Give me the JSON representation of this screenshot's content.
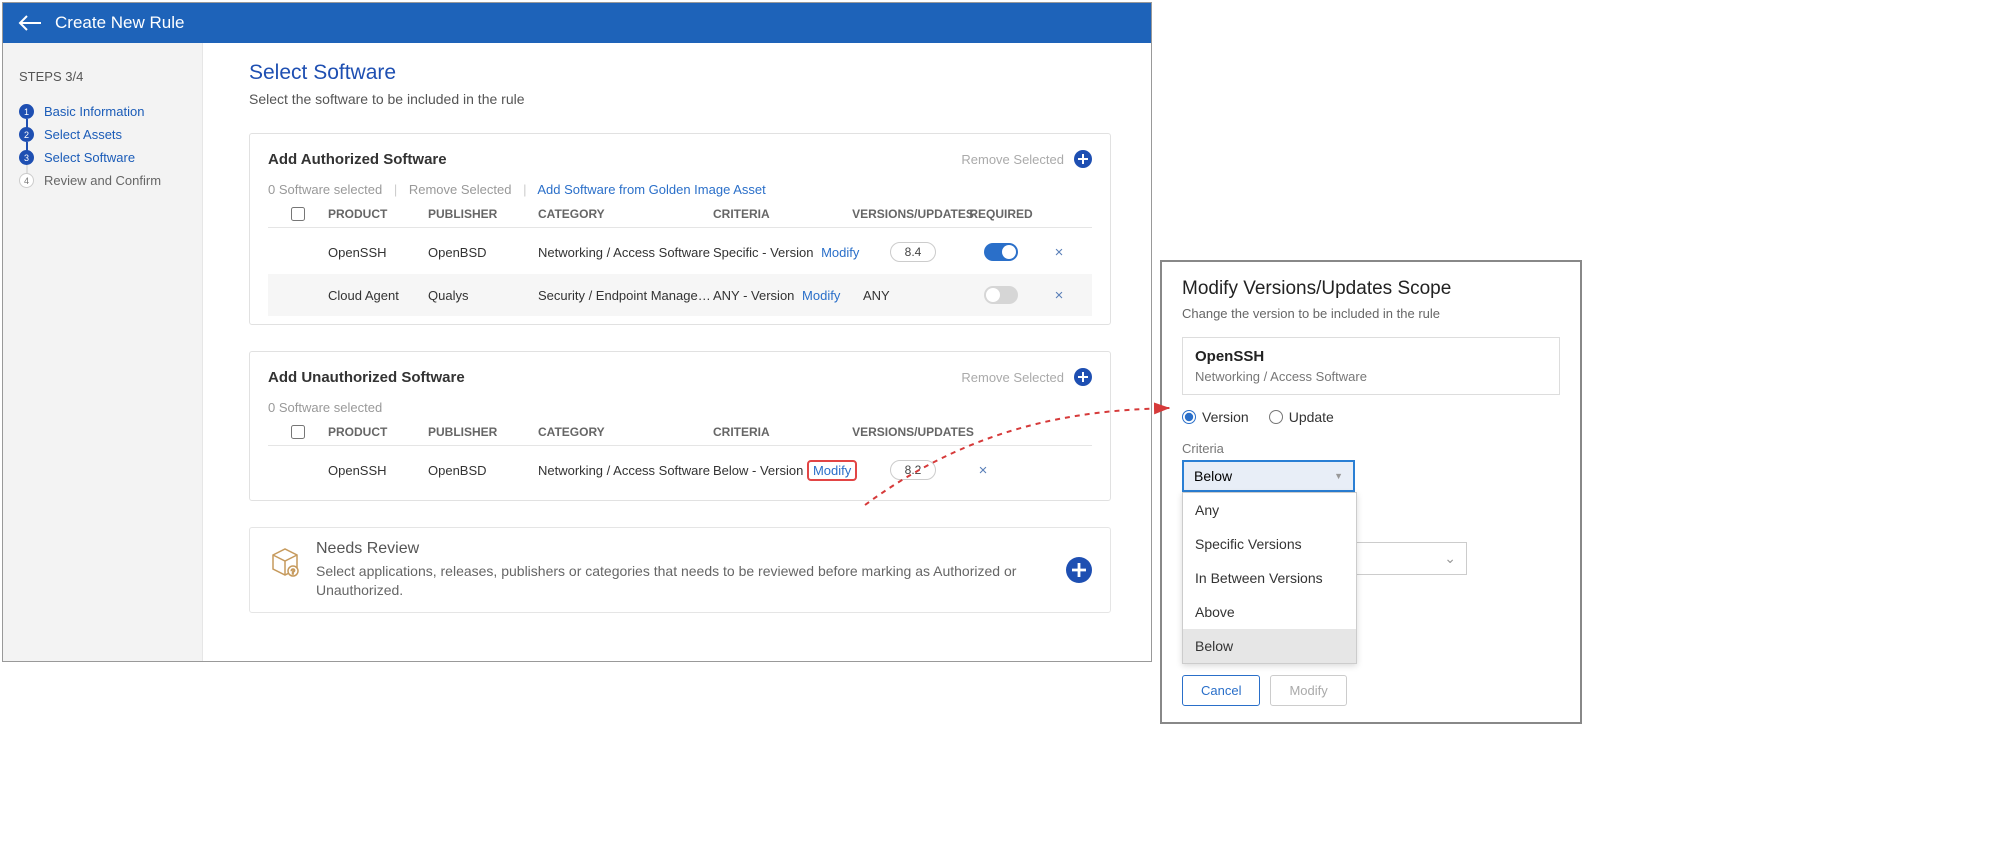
{
  "header": {
    "title": "Create New Rule"
  },
  "sidebar": {
    "steps_label": "STEPS 3/4",
    "steps": [
      {
        "num": "1",
        "label": "Basic Information",
        "done": true
      },
      {
        "num": "2",
        "label": "Select Assets",
        "done": true
      },
      {
        "num": "3",
        "label": "Select Software",
        "done": true
      },
      {
        "num": "4",
        "label": "Review and Confirm",
        "done": false
      }
    ]
  },
  "main": {
    "title": "Select Software",
    "subtitle": "Select the software to be included in the rule"
  },
  "auth": {
    "title": "Add Authorized Software",
    "remove_selected": "Remove Selected",
    "selbar_selected": "0 Software selected",
    "selbar_remove": "Remove Selected",
    "selbar_golden": "Add Software from Golden Image Asset",
    "headers": {
      "product": "PRODUCT",
      "publisher": "PUBLISHER",
      "category": "CATEGORY",
      "criteria": "CRITERIA",
      "versions": "VERSIONS/UPDATES",
      "required": "REQUIRED"
    },
    "rows": [
      {
        "product": "OpenSSH",
        "publisher": "OpenBSD",
        "category": "Networking / Access Software",
        "criteria": "Specific - Version",
        "modify": "Modify",
        "version": "8.4",
        "required_on": true
      },
      {
        "product": "Cloud Agent",
        "publisher": "Qualys",
        "category": "Security / Endpoint Managem...",
        "criteria": "ANY - Version",
        "modify": "Modify",
        "version": "ANY",
        "required_on": false
      }
    ]
  },
  "unauth": {
    "title": "Add Unauthorized Software",
    "remove_selected": "Remove Selected",
    "selbar_selected": "0 Software selected",
    "headers": {
      "product": "PRODUCT",
      "publisher": "PUBLISHER",
      "category": "CATEGORY",
      "criteria": "CRITERIA",
      "versions": "VERSIONS/UPDATES"
    },
    "rows": [
      {
        "product": "OpenSSH",
        "publisher": "OpenBSD",
        "category": "Networking / Access Software",
        "criteria": "Below - Version",
        "modify": "Modify",
        "version": "8.2"
      }
    ]
  },
  "review": {
    "title": "Needs Review",
    "text": "Select applications, releases, publishers or categories that needs to be reviewed before marking as Authorized or Unauthorized."
  },
  "popup": {
    "title": "Modify Versions/Updates Scope",
    "subtitle": "Change the version to be included in the rule",
    "software_name": "OpenSSH",
    "software_cat": "Networking / Access Software",
    "radio_version": "Version",
    "radio_update": "Update",
    "criteria_label": "Criteria",
    "criteria_selected": "Below",
    "criteria_options": [
      "Any",
      "Specific Versions",
      "In Between Versions",
      "Above",
      "Below"
    ],
    "btn_cancel": "Cancel",
    "btn_modify": "Modify"
  }
}
